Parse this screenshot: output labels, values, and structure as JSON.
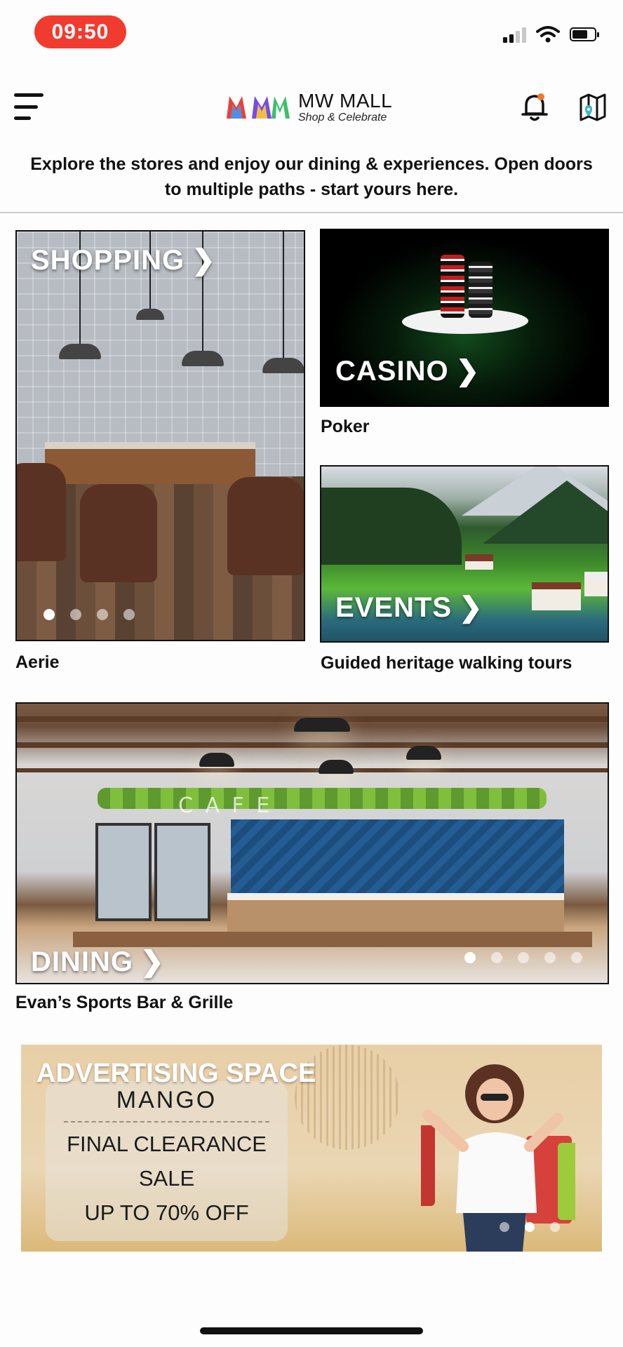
{
  "status_bar": {
    "time": "09:50"
  },
  "header": {
    "logo_title": "MW MALL",
    "logo_tagline": "Shop & Celebrate"
  },
  "intro_text": "Explore the stores and enjoy our dining & experiences. Open doors to multiple paths - start yours here.",
  "sections": {
    "shopping": {
      "title": "SHOPPING",
      "caption": "Aerie",
      "slide_count": 4,
      "active_slide": 1
    },
    "casino": {
      "title": "CASINO",
      "caption": "Poker"
    },
    "events": {
      "title": "EVENTS",
      "caption": "Guided heritage walking tours"
    },
    "dining": {
      "title": "DINING",
      "caption": "Evan’s Sports Bar & Grille",
      "slide_count": 5,
      "active_slide": 1,
      "sign_text": "C A F E"
    }
  },
  "advertising": {
    "title": "ADVERTISING SPACE",
    "brand": "MANGO",
    "line1": "FINAL CLEARANCE",
    "line2": "SALE",
    "line3": "UP TO 70% OFF",
    "slide_count": 3,
    "active_slide": 2
  },
  "icons": {
    "menu": "hamburger-menu-icon",
    "notifications": "bell-icon",
    "map": "map-icon",
    "chevron": "chevron-right-icon"
  },
  "colors": {
    "time_pill": "#f23b2f",
    "notification_dot": "#f07a2a",
    "map_pin": "#3bb8c9"
  }
}
